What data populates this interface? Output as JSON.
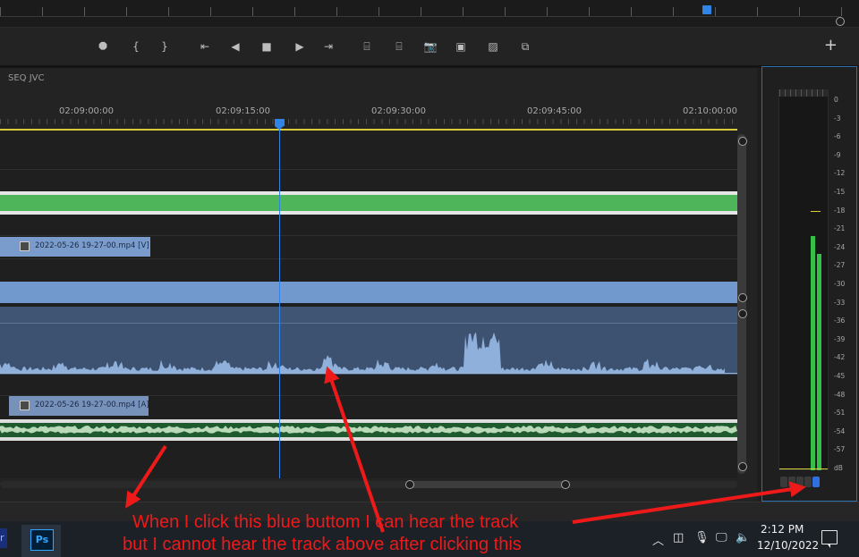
{
  "sequence": {
    "title": "SEQ JVC"
  },
  "ruler": {
    "timecodes": [
      "02:09:00:00",
      "02:09:15:00",
      "02:09:30:00",
      "02:09:45:00",
      "02:10:00:00"
    ]
  },
  "transport": {
    "buttons": [
      {
        "name": "add-marker-button",
        "glyph": "⯃",
        "icon": "marker-icon"
      },
      {
        "name": "mark-in-button",
        "glyph": "{",
        "icon": "mark-in-icon"
      },
      {
        "name": "mark-out-button",
        "glyph": "}",
        "icon": "mark-out-icon"
      },
      {
        "name": "go-to-in-button",
        "glyph": "⇤",
        "icon": "go-to-in-icon"
      },
      {
        "name": "step-back-button",
        "glyph": "◀",
        "icon": "step-back-icon"
      },
      {
        "name": "stop-button",
        "glyph": "■",
        "icon": "stop-icon"
      },
      {
        "name": "step-forward-button",
        "glyph": "▶",
        "icon": "step-forward-icon"
      },
      {
        "name": "go-to-out-button",
        "glyph": "⇥",
        "icon": "go-to-out-icon"
      },
      {
        "name": "lift-button",
        "glyph": "⌸",
        "icon": "lift-icon"
      },
      {
        "name": "extract-button",
        "glyph": "⌸",
        "icon": "extract-icon"
      },
      {
        "name": "export-frame-button",
        "glyph": "📷",
        "icon": "camera-icon"
      },
      {
        "name": "insert-button",
        "glyph": "▣",
        "icon": "insert-icon"
      },
      {
        "name": "overwrite-button",
        "glyph": "▨",
        "icon": "overwrite-icon"
      },
      {
        "name": "compare-button",
        "glyph": "⧉",
        "icon": "compare-icon"
      }
    ],
    "add_label": "+"
  },
  "clips": {
    "video": "2022-05-26 19-27-00.mp4 [V]",
    "audio": "2022-05-26 19-27-00.mp4 [A]"
  },
  "meter": {
    "scale": [
      "0",
      "-3",
      "-6",
      "-9",
      "-12",
      "-15",
      "-18",
      "-21",
      "-24",
      "-27",
      "-30",
      "-33",
      "-36",
      "-39",
      "-42",
      "-45",
      "-48",
      "-51",
      "-54",
      "-57",
      "dB"
    ],
    "level_left_fraction": 0.62,
    "level_right_fraction": 0.57,
    "solo_active": "S"
  },
  "taskbar": {
    "app_label": "Ps",
    "time": "2:12 PM",
    "date": "12/10/2022",
    "tray_icons": [
      "chevron-up-icon",
      "webcam-icon",
      "microphone-icon",
      "network-icon",
      "volume-icon"
    ]
  },
  "annotation": {
    "line1": "When I click this blue buttom I can hear the track",
    "line2": "but I cannot hear the track above after clicking this",
    "color": "#ee1a1a"
  },
  "colors": {
    "accent": "#2f84e6",
    "clip_video": "#7199cd",
    "clip_audio": "#3c5270",
    "track_green": "#4fb55b",
    "meter_green": "#34c048",
    "annotation_red": "#ee1a1a"
  }
}
